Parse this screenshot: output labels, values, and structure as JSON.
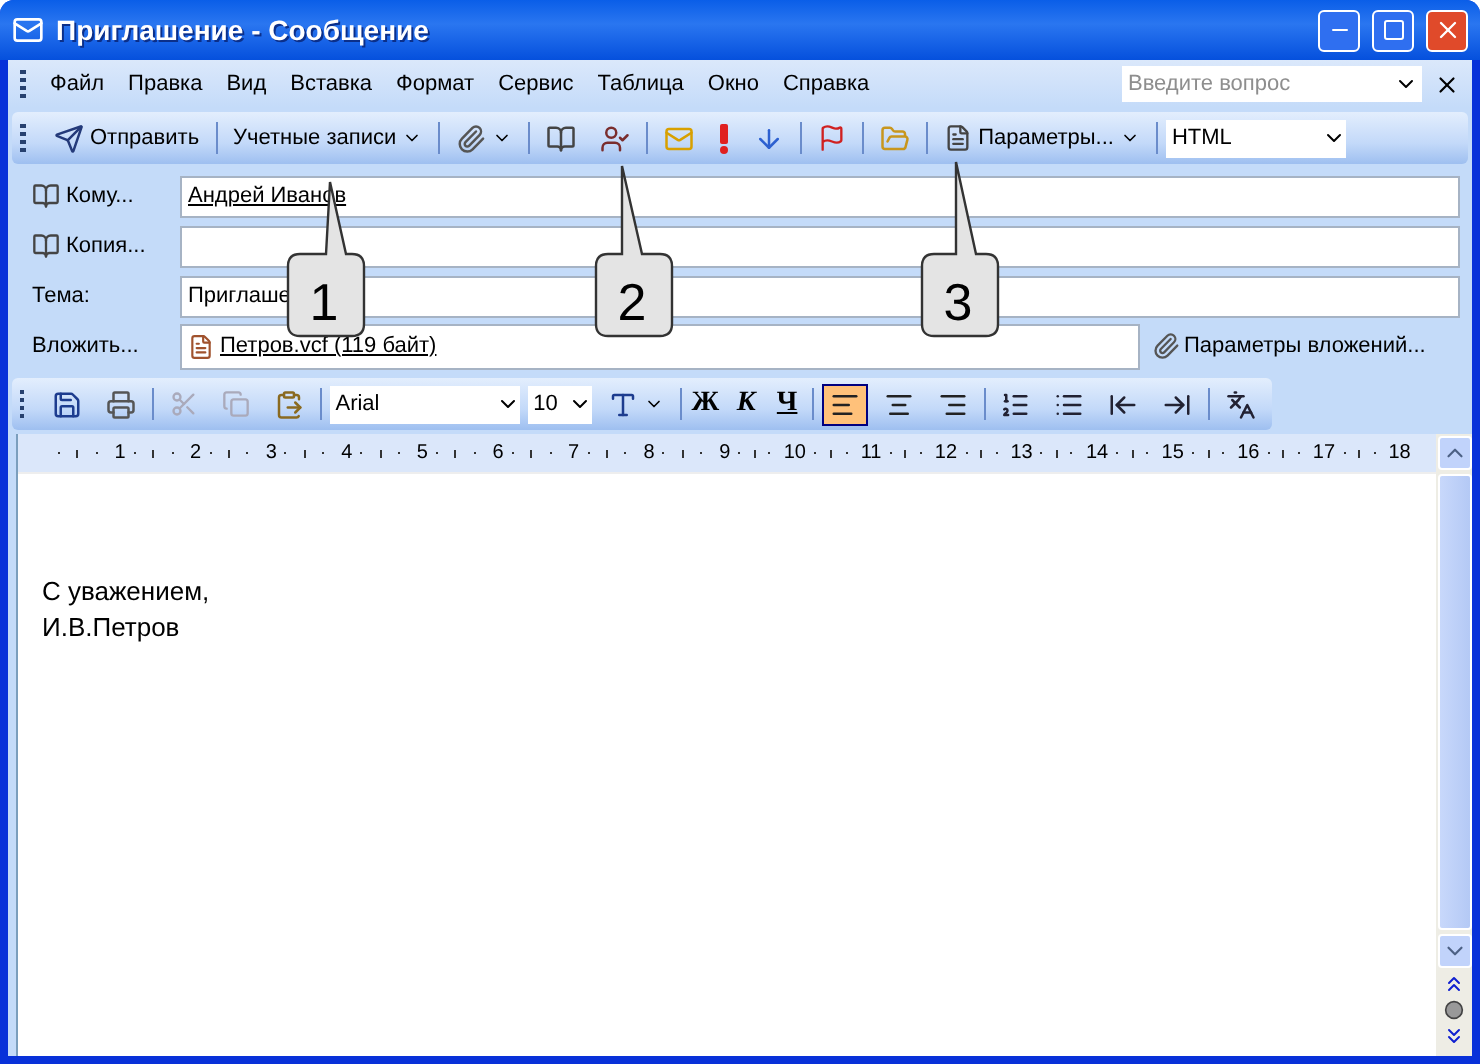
{
  "window": {
    "title": "Приглашение - Сообщение"
  },
  "menu": {
    "items": [
      "Файл",
      "Правка",
      "Вид",
      "Вставка",
      "Формат",
      "Сервис",
      "Таблица",
      "Окно",
      "Справка"
    ],
    "help_search": {
      "placeholder": "Введите вопрос"
    }
  },
  "toolbar": {
    "send": "Отправить",
    "accounts": "Учетные записи",
    "options": "Параметры...",
    "format": "HTML"
  },
  "fields": [
    {
      "kind": "button",
      "label": "Кому...",
      "value": "Андрей Иванов"
    },
    {
      "kind": "button",
      "label": "Копия..."
    },
    {
      "kind": "plain",
      "label": "Тема:",
      "value": "Приглаше"
    }
  ],
  "attach": {
    "label": "Вложить...",
    "file": "Петров.vcf (119 байт)",
    "options": "Параметры вложений..."
  },
  "format_bar": {
    "font": "Arial",
    "size": "10",
    "bold": "Ж",
    "italic": "К",
    "underline": "Ч",
    "align": [
      {
        "kind": "left",
        "selected": true
      },
      {
        "kind": "center",
        "selected": false
      },
      {
        "kind": "right",
        "selected": false
      }
    ]
  },
  "ruler": [
    "1",
    "2",
    "3",
    "4",
    "5",
    "6",
    "7",
    "8",
    "9",
    "10",
    "11",
    "12",
    "13",
    "14",
    "15",
    "16",
    "17",
    "18"
  ],
  "body": [
    "С уважением,",
    "И.В.Петров"
  ],
  "callouts": [
    "1",
    "2",
    "3"
  ]
}
